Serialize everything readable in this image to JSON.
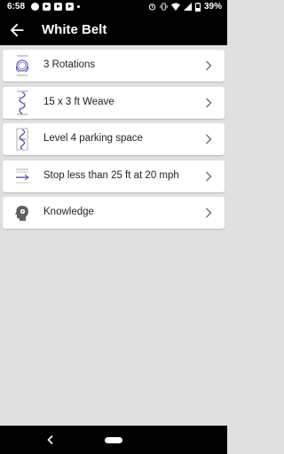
{
  "status_bar": {
    "time": "6:58",
    "battery": "39%"
  },
  "app_bar": {
    "title": "White Belt"
  },
  "items": [
    {
      "label": "3 Rotations",
      "icon": "rotations-diagram-icon"
    },
    {
      "label": "15 x 3 ft Weave",
      "icon": "weave-diagram-icon"
    },
    {
      "label": "Level 4 parking space",
      "icon": "parking-diagram-icon"
    },
    {
      "label": "Stop less than 25 ft at 20 mph",
      "icon": "stop-diagram-icon"
    },
    {
      "label": "Knowledge",
      "icon": "knowledge-head-icon"
    }
  ],
  "colors": {
    "accent": "#3f3fa8",
    "background": "#e0e0e0",
    "card": "#ffffff",
    "bar": "#000000"
  }
}
